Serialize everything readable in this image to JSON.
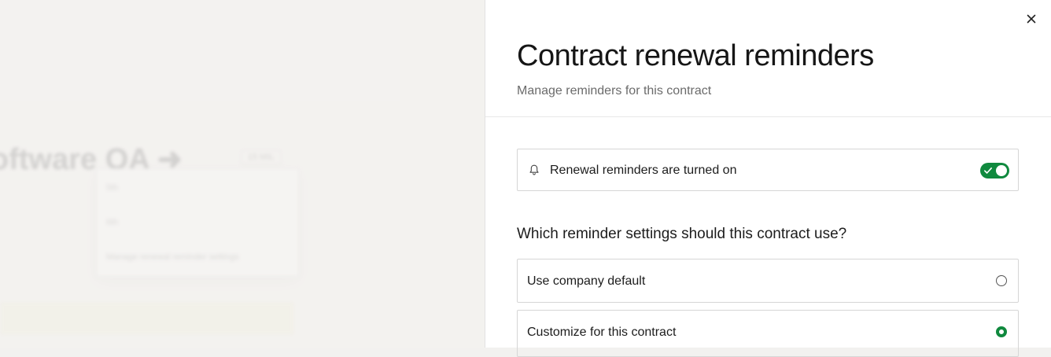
{
  "background": {
    "title": "oftware QA",
    "pill": "15 MIL",
    "dropdown_items": [
      "5th",
      "6th",
      "Manage renewal reminder settings"
    ]
  },
  "drawer": {
    "title": "Contract renewal reminders",
    "subtitle": "Manage reminders for this contract",
    "reminder_toggle": {
      "label": "Renewal reminders are turned on",
      "on": true
    },
    "question": "Which reminder settings should this contract use?",
    "options": [
      {
        "label": "Use company default",
        "selected": false
      },
      {
        "label": "Customize for this contract",
        "selected": true
      }
    ]
  },
  "colors": {
    "accent": "#10893e",
    "border": "#d6d6d6",
    "subtitle": "#6b6b6b"
  },
  "icons": {
    "close": "close-icon",
    "bell": "bell-icon",
    "check": "check-icon",
    "arrow": "arrow-right-icon"
  }
}
